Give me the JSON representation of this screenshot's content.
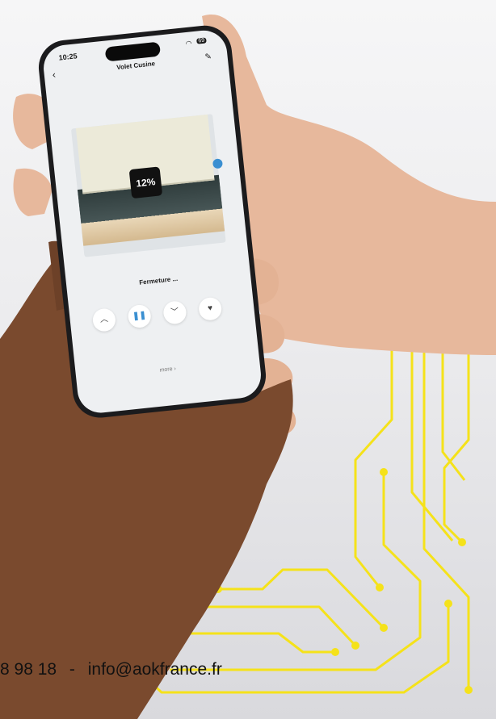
{
  "status_bar": {
    "time": "10:25",
    "battery": "69"
  },
  "header": {
    "title": "Volet Cusine"
  },
  "blind": {
    "percent_label": "12%",
    "position_fraction": 0.12
  },
  "status_text": "Fermeture ...",
  "controls": {
    "up_label": "up",
    "pause_label": "pause",
    "down_label": "down",
    "favorite_label": "favorite"
  },
  "more_link": "more ›",
  "footer": {
    "phone_fragment": "8 98 18",
    "separator": "-",
    "email": "info@aokfrance.fr"
  },
  "colors": {
    "accent": "#3a8fd1",
    "circuit": "#f5e21a",
    "screen_bg": "#eef0f2"
  }
}
